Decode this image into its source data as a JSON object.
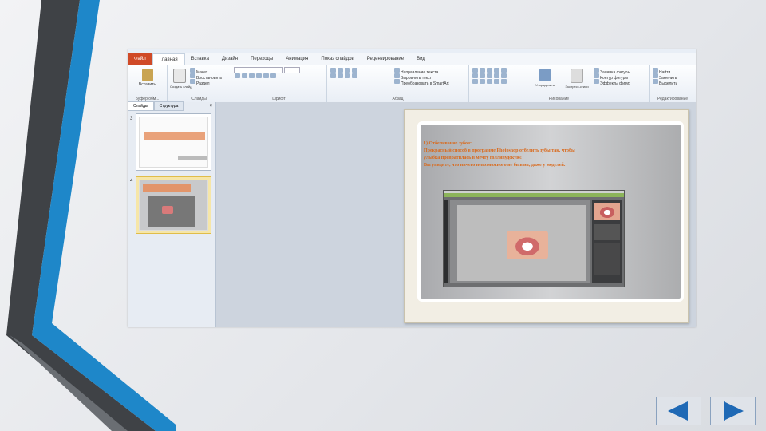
{
  "ribbon": {
    "tabs": [
      "Файл",
      "Главная",
      "Вставка",
      "Дизайн",
      "Переходы",
      "Анимация",
      "Показ слайдов",
      "Рецензирование",
      "Вид"
    ],
    "groups": {
      "clipboard": {
        "paste": "Вставить",
        "label": "Буфер обм..."
      },
      "slides": {
        "create": "Создать слайд",
        "layout": "Макет",
        "reset": "Восстановить",
        "section": "Раздел",
        "label": "Слайды"
      },
      "font": {
        "label": "Шрифт"
      },
      "paragraph": {
        "direction": "Направление текста",
        "align": "Выровнять текст",
        "smartart": "Преобразовать в SmartArt",
        "label": "Абзац"
      },
      "drawing": {
        "arrange": "Упорядочить",
        "styles": "Экспресс-стили",
        "fill": "Заливка фигуры",
        "outline": "Контур фигуры",
        "effects": "Эффекты фигур",
        "label": "Рисование"
      },
      "editing": {
        "find": "Найти",
        "replace": "Заменить",
        "select": "Выделить",
        "label": "Редактирование"
      }
    }
  },
  "sidepane": {
    "tab_slides": "Слайды",
    "tab_outline": "Структура",
    "close": "×",
    "slide_numbers": [
      "3",
      "4"
    ]
  },
  "slide": {
    "lines": [
      "1) Отбеливание зубов:",
      "Прекрасный способ в программе Photoshop отбелить зубы так, чтобы",
      "улыбка превратилась в мечту голливудскую!",
      "Вы увидите, что ничего невозможного не бывает, даже у моделей."
    ]
  },
  "nav": {
    "prev": "Previous",
    "next": "Next"
  }
}
